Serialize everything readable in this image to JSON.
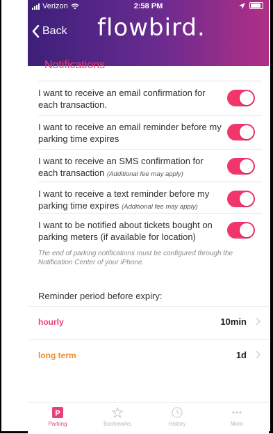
{
  "status": {
    "carrier": "Verizon",
    "time": "2:58 PM"
  },
  "nav": {
    "back_label": "Back",
    "brand": "flowbird."
  },
  "section_title": "Notifications",
  "toggles": [
    {
      "text": "I want to receive an email confirmation for each transaction.",
      "note": "",
      "on": true
    },
    {
      "text": "I want to receive an email reminder before my parking time expires",
      "note": "",
      "on": true
    },
    {
      "text": "I want to receive an SMS confirmation for each transaction",
      "note": "(Additional fee may apply)",
      "on": true
    },
    {
      "text": "I want to receive a text reminder before my parking time expires",
      "note": "(Additional fee may apply)",
      "on": true
    },
    {
      "text": "I want to be notified about tickets bought on parking meters (if available for location)",
      "note": "",
      "on": true
    }
  ],
  "footnote": "The end of parking notifications must be configured through the Notification Center of your iPhone.",
  "reminder_label": "Reminder period before expiry:",
  "periods": [
    {
      "name": "hourly",
      "value": "10min",
      "color": "#e8417a"
    },
    {
      "name": "long term",
      "value": "1d",
      "color": "#f08a2a"
    }
  ],
  "tabs": [
    {
      "label": "Parking",
      "icon": "parking-icon",
      "active": true
    },
    {
      "label": "Bookmarks",
      "icon": "bookmarks-icon",
      "active": false
    },
    {
      "label": "History",
      "icon": "history-icon",
      "active": false
    },
    {
      "label": "More",
      "icon": "more-icon",
      "active": false
    }
  ],
  "colors": {
    "accent": "#e8417a",
    "header_start": "#3d1f7a",
    "header_end": "#b12f86",
    "toggle_on": "#f0366a"
  }
}
